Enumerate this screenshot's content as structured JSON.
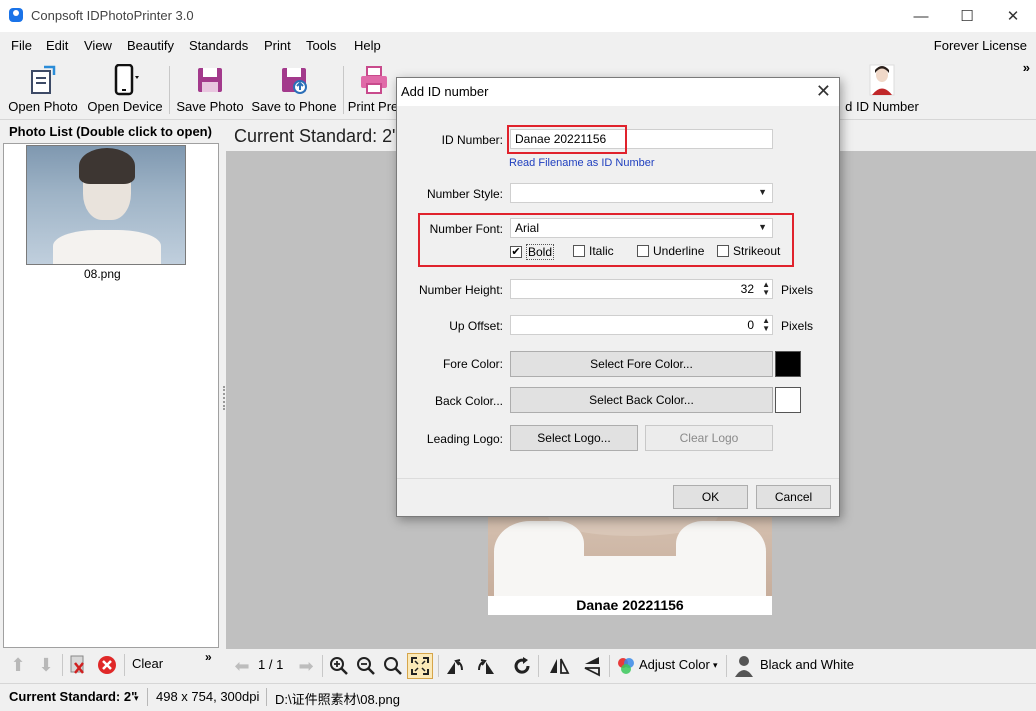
{
  "app": {
    "title": "Conpsoft IDPhotoPrinter 3.0",
    "controls": {
      "minimize": "—",
      "maximize": "☐",
      "close": "✕"
    }
  },
  "menu": {
    "items": [
      "File",
      "Edit",
      "View",
      "Beautify",
      "Standards",
      "Print",
      "Tools",
      "Help"
    ],
    "license": "Forever License"
  },
  "toolbar": {
    "open_photo": "Open Photo",
    "open_device": "Open Device",
    "save_photo": "Save to Photo",
    "save_photo_visible": "Save Photo",
    "save_phone": "Save to Phone",
    "print_preview": "Print Pre",
    "id_number": "d ID Number",
    "more": "»"
  },
  "left_panel": {
    "header": "Photo List (Double click to open)",
    "photos": [
      {
        "name": "08.png"
      }
    ],
    "clear_label": "Clear",
    "more": "»"
  },
  "main": {
    "current_standard": "Current Standard: 2\"",
    "id_text": "Danae 20221156",
    "page_indicator": "1 / 1",
    "adjust_color": "Adjust Color",
    "black_white": "Black and White"
  },
  "status": {
    "standard": "Current Standard: 2\"",
    "dimensions": "498 x 754, 300dpi",
    "path": "D:\\证件照素材\\08.png"
  },
  "dialog": {
    "title": "Add ID number",
    "id_number_label": "ID Number:",
    "id_number_value": "Danae 20221156",
    "read_filename_link": "Read Filename as ID Number",
    "number_style_label": "Number Style:",
    "number_style_value": "",
    "number_font_label": "Number Font:",
    "number_font_value": "Arial",
    "bold_label": "Bold",
    "bold_checked": true,
    "italic_label": "Italic",
    "underline_label": "Underline",
    "strikeout_label": "Strikeout",
    "number_height_label": "Number Height:",
    "number_height_value": "32",
    "up_offset_label": "Up Offset:",
    "up_offset_value": "0",
    "pixels_unit": "Pixels",
    "fore_color_label": "Fore Color:",
    "fore_color_button": "Select Fore Color...",
    "fore_color": "#000000",
    "back_color_label": "Back Color...",
    "back_color_button": "Select Back Color...",
    "back_color": "#ffffff",
    "leading_logo_label": "Leading Logo:",
    "select_logo_button": "Select Logo...",
    "clear_logo_button": "Clear Logo",
    "ok_button": "OK",
    "cancel_button": "Cancel"
  },
  "colors": {
    "accent": "#1a73e8",
    "highlight_red": "#e0222c",
    "link_blue": "#1f3fbf",
    "canvas_gray": "#c0c0c0"
  }
}
